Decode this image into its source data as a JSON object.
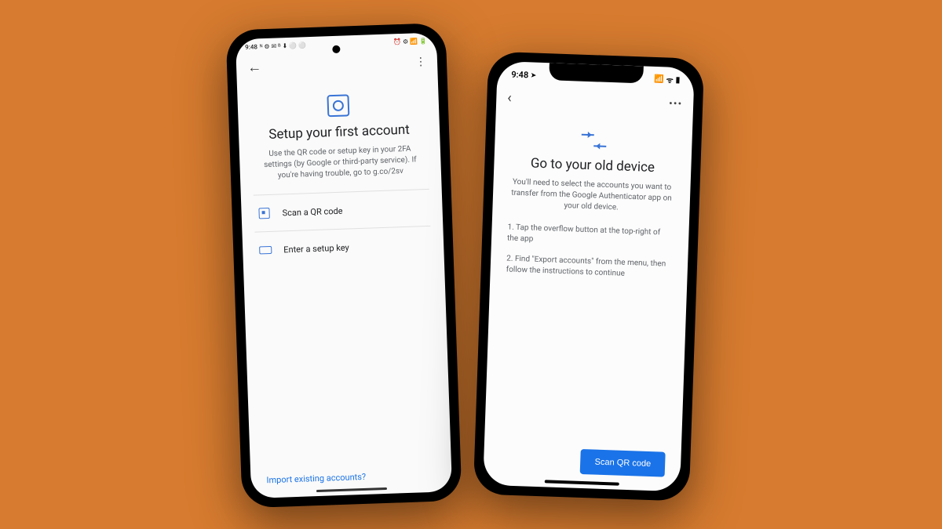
{
  "left": {
    "status": {
      "time": "9:48",
      "left_icons": "ᴺ ⚙ ✉ ᴮ ⬇ ⚪ ⚪",
      "right_icons": "⏰ ⚙ 📶 🔋"
    },
    "title": "Setup your first account",
    "subtitle": "Use the QR code or setup key in your 2FA settings (by Google or third-party service). If you're having trouble, go to g.co/2sv",
    "option_scan": "Scan a QR code",
    "option_key": "Enter a setup key",
    "footer_link": "Import existing accounts?"
  },
  "right": {
    "status": {
      "time": "9:48",
      "nav_icon": "➤",
      "signal": "📶",
      "wifi": "ᯤ",
      "battery": "▮"
    },
    "title": "Go to your old device",
    "subtitle": "You'll need to select the accounts you want to transfer from the Google Authenticator app on your old device.",
    "step1": "1. Tap the overflow button at the top-right of the app",
    "step2": "2. Find \"Export accounts\" from the menu, then follow the instructions to continue",
    "button": "Scan QR code"
  }
}
